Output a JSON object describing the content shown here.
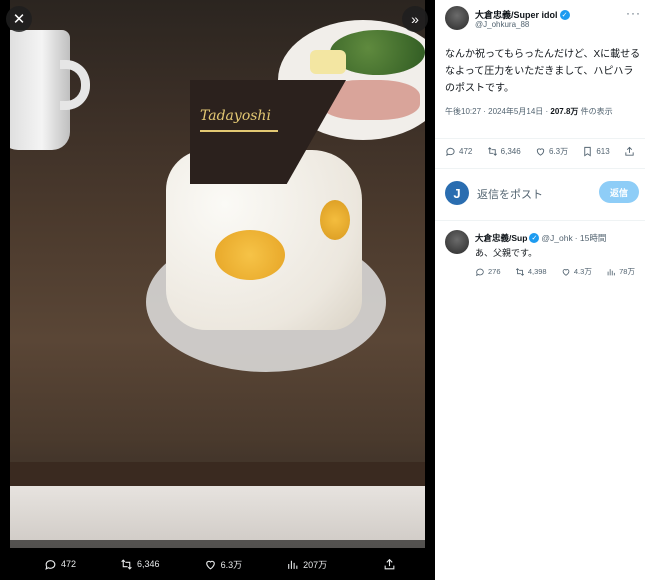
{
  "viewer": {
    "plaque_text": "Tadayoshi",
    "actions": {
      "reply_count": "472",
      "repost_count": "6,346",
      "like_count": "6.3万",
      "view_count": "207万"
    }
  },
  "tweet": {
    "author_name": "大倉忠義/Super idol",
    "handle": "@J_ohkura_88",
    "text": "なんか祝ってもらったんだけど、Xに載せるなよって圧力をいただきまして、ハピハラのポストです。",
    "time": "午後10:27 · 2024年5月14日 · ",
    "views": "207.8万",
    "views_suffix": " 件の表示",
    "stats": {
      "replies": "472",
      "reposts": "6,346",
      "likes": "6.3万",
      "bookmarks": "613"
    }
  },
  "reply_box": {
    "avatar_letter": "J",
    "placeholder": "返信をポスト",
    "button_label": "返信"
  },
  "reply": {
    "author_name": "大倉忠義/Sup",
    "handle": "@J_ohk",
    "time": "· 15時間",
    "text": "あ、父親です。",
    "stats": {
      "replies": "276",
      "reposts": "4,398",
      "likes": "4.3万",
      "views": "78万"
    }
  },
  "colors": {
    "accent": "#1d9bf0",
    "reply_button": "#8ecdf7",
    "muted_text": "#536471"
  }
}
